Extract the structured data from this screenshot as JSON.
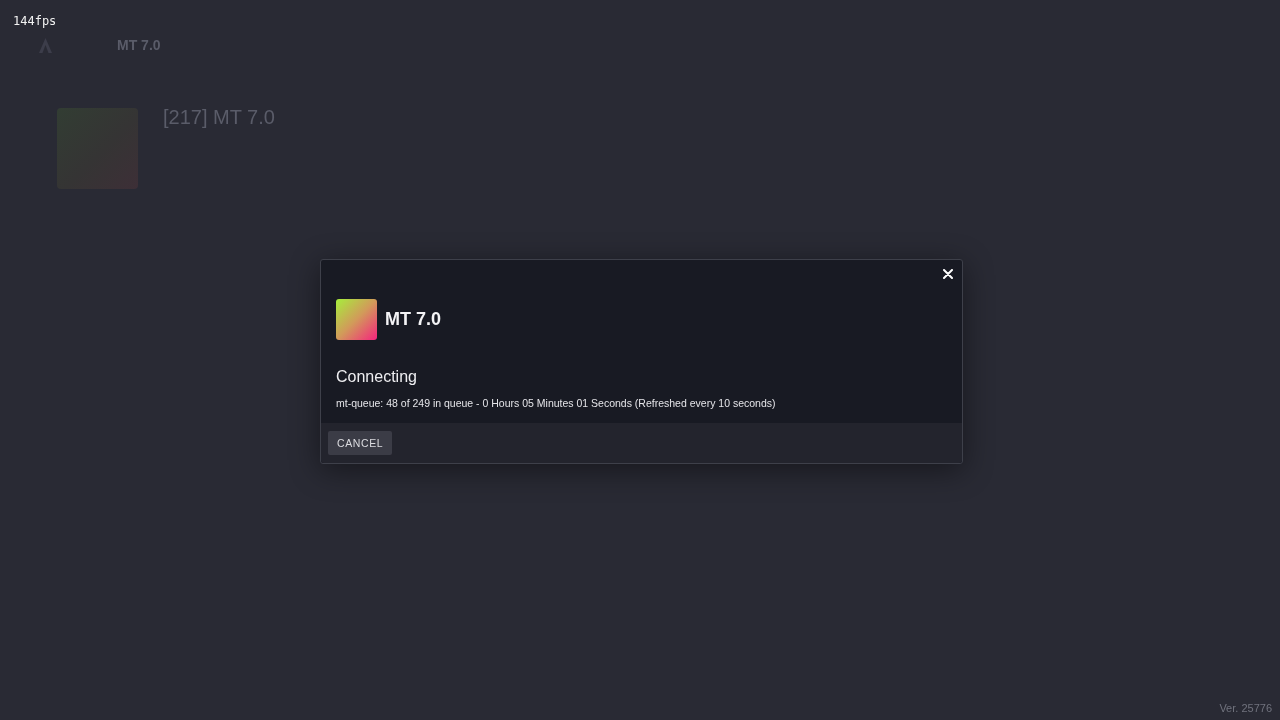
{
  "fps_counter": "144fps",
  "background": {
    "top_bar": {
      "title": "MT 7.0"
    },
    "server": {
      "title": "[217] MT 7.0"
    }
  },
  "dialog": {
    "server_name": "MT 7.0",
    "status": "Connecting",
    "message": "mt-queue: 48 of 249 in queue - 0 Hours 05 Minutes 01 Seconds (Refreshed every 10 seconds)",
    "buttons": [
      "CANCEL"
    ]
  },
  "version": "Ver. 25776"
}
